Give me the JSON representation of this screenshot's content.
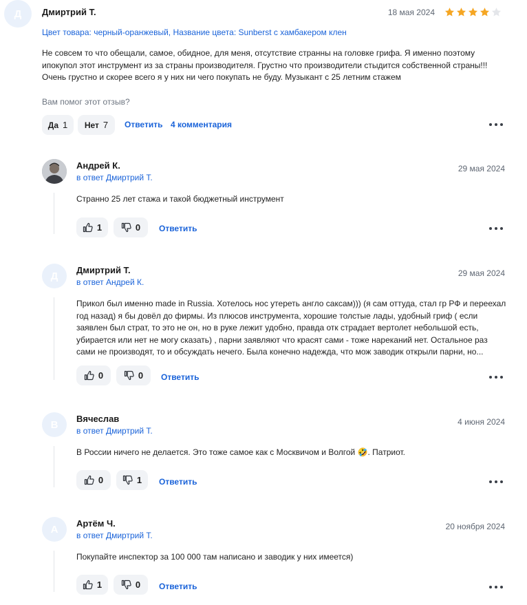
{
  "review": {
    "avatar_letter": "Д",
    "author": "Дмиртрий Т.",
    "date": "18 мая 2024",
    "rating": 4,
    "rating_max": 5,
    "variant": "Цвет товара: черный-оранжевый, Название цвета: Sunberst с хамбакером клен",
    "text": "Не совсем то что обещали, самое, обидное, для меня, отсутствие странны на головке грифа. Я именно поэтому ипокупол этот инструмент из за страны производителя. Грустно что производители стыдится собственной страны!!! Очень грустно и скорее всего я у них ни чего покупать не буду. Музыкант с 25 летним стажем",
    "helpful_question": "Вам помог этот отзыв?",
    "yes_label": "Да",
    "yes_count": "1",
    "no_label": "Нет",
    "no_count": "7",
    "reply_label": "Ответить",
    "comments_label": "4 комментария"
  },
  "comments": [
    {
      "author": "Андрей К.",
      "avatar_letter": "",
      "avatar_photo": true,
      "reply_to": "в ответ Дмиртрий Т.",
      "date": "29 мая 2024",
      "text": "Странно 25 лет стажа и такой бюджетный инструмент",
      "likes": "1",
      "dislikes": "0",
      "reply_label": "Ответить"
    },
    {
      "author": "Дмиртрий Т.",
      "avatar_letter": "Д",
      "reply_to": "в ответ Андрей К.",
      "date": "29 мая 2024",
      "text": "Прикол был именно made in Russia. Хотелось нос утереть англо саксам))) (я сам оттуда, стал гр РФ и переехал год назад) я бы довёл до фирмы. Из плюсов инструмента, хорошие толстые лады, удобный гриф ( если заявлен был страт, то это не он, но в руке лежит удобно, правда отк страдает вертолет небольшой есть, убирается или нет не могу сказать) , парни заявляют что красят сами - тоже нареканий нет. Остальное раз сами не производят, то и обсуждать нечего. Была конечно надежда, что мож заводик открыли парни, но...",
      "likes": "0",
      "dislikes": "0",
      "reply_label": "Ответить"
    },
    {
      "author": "Вячеслав",
      "avatar_letter": "В",
      "reply_to": "в ответ Дмиртрий Т.",
      "date": "4 июня 2024",
      "text": "В России ничего не делается. Это тоже самое как с Москвичом и Волгой 🤣. Патриот.",
      "likes": "0",
      "dislikes": "1",
      "reply_label": "Ответить"
    },
    {
      "author": "Артём Ч.",
      "avatar_letter": "А",
      "reply_to": "в ответ Дмиртрий Т.",
      "date": "20 ноября 2024",
      "text": "Покупайте инспектор за 100 000 там написано и заводик у них имеется)",
      "likes": "1",
      "dislikes": "0",
      "reply_label": "Ответить"
    }
  ],
  "colors": {
    "link": "#1a63d9",
    "star": "#f5a623",
    "star_empty": "#e4e6ea",
    "pill_bg": "#f1f3f6",
    "avatar_bg": "#eaf1fb"
  }
}
